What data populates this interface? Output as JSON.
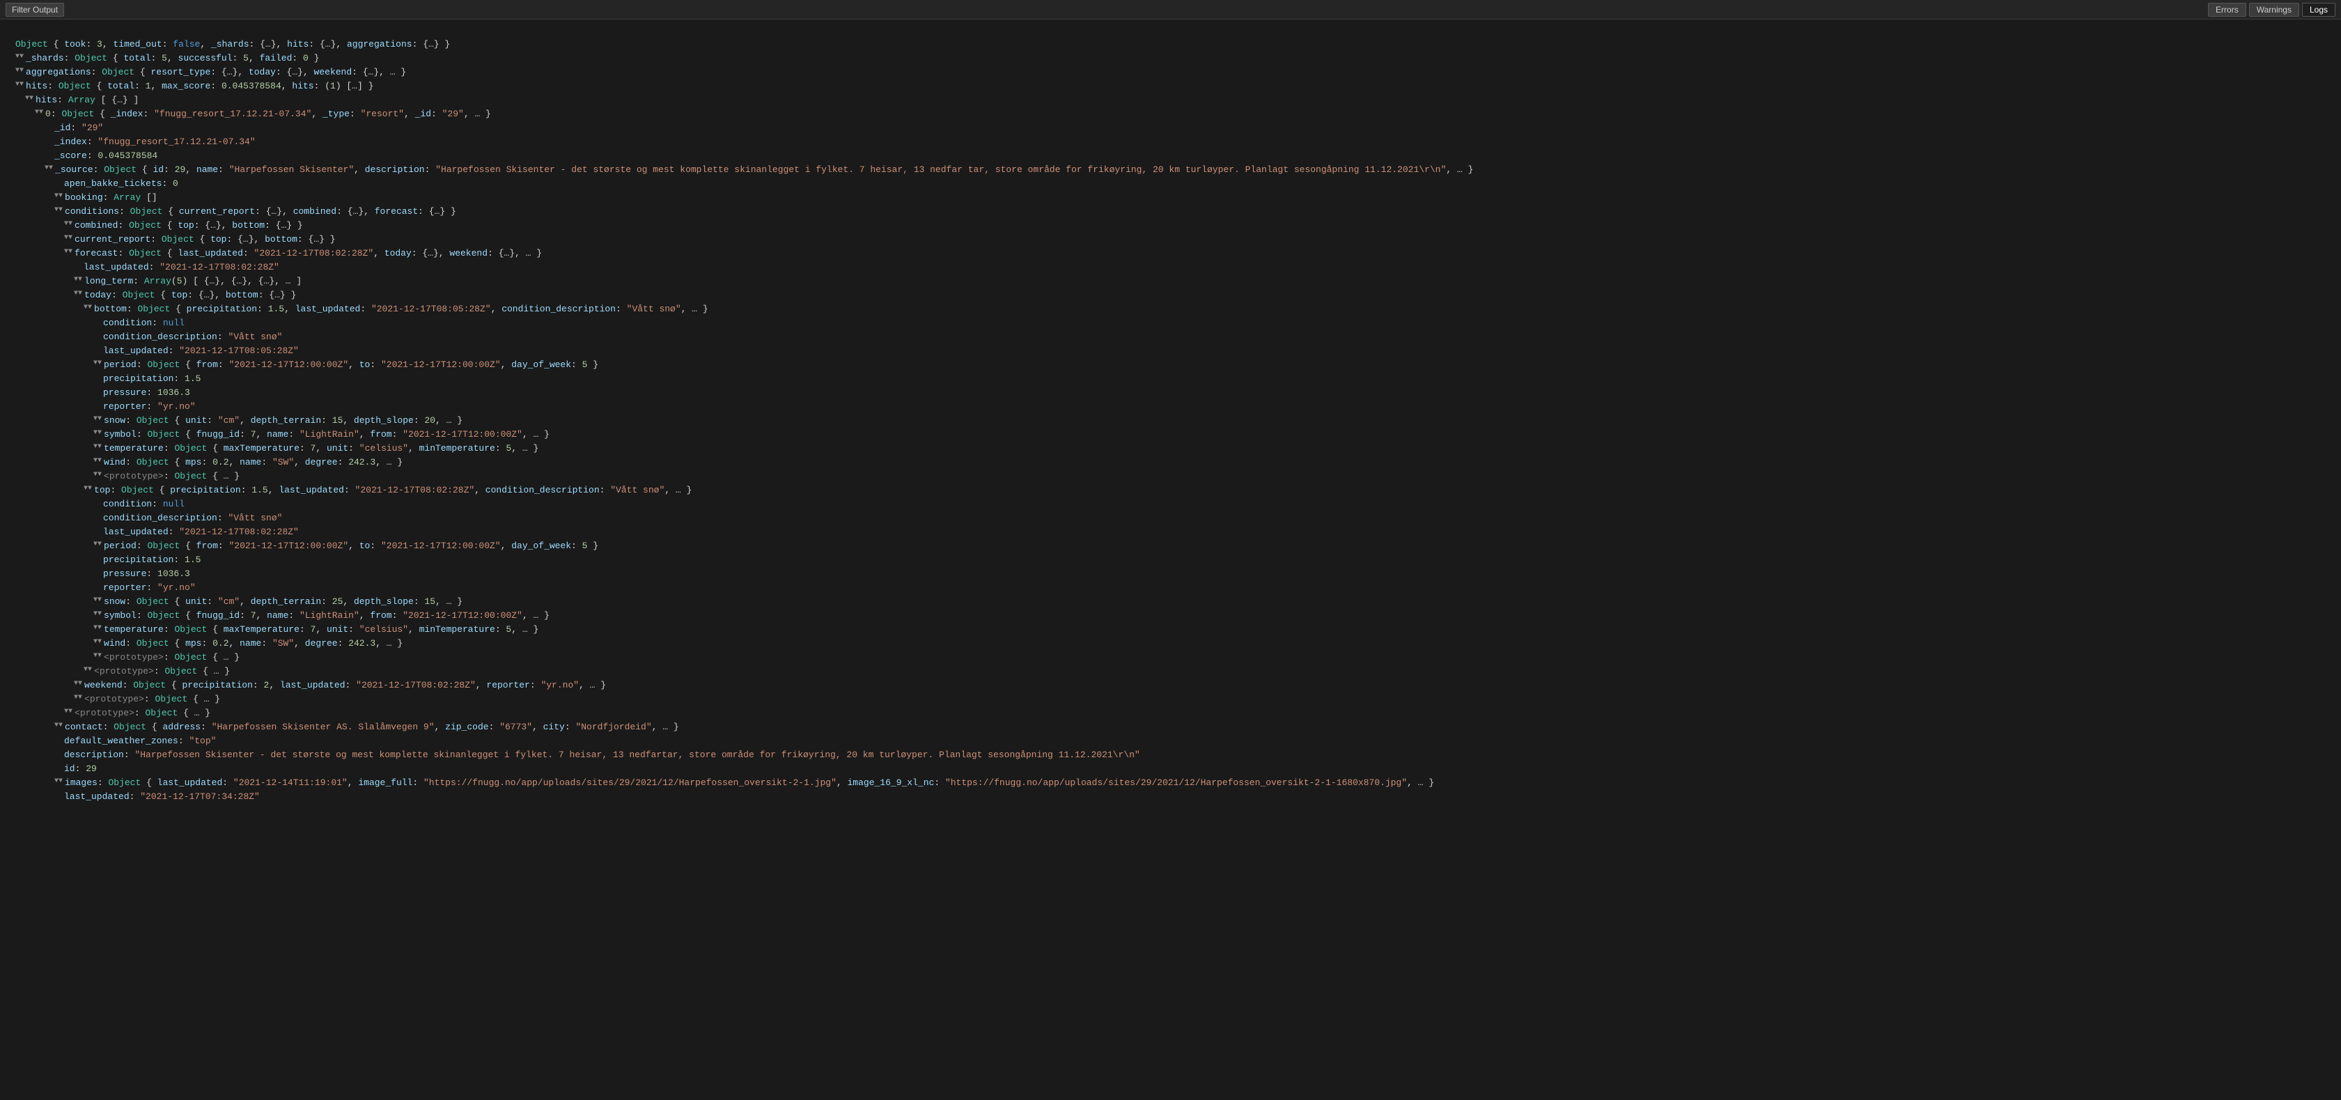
{
  "toolbar": {
    "filter_label": "Filter Output",
    "errors_label": "Errors",
    "warnings_label": "Warnings",
    "logs_label": "Logs"
  },
  "output": {
    "lines": [
      {
        "indent": 0,
        "toggle": false,
        "content": "Object { took: 3, timed_out: false, _shards: {…}, hits: {…}, aggregations: {…} }"
      },
      {
        "indent": 1,
        "toggle": true,
        "key": "_shards",
        "content": "_shards: Object { total: 5, successful: 5, failed: 0 }"
      },
      {
        "indent": 1,
        "toggle": true,
        "key": "aggregations",
        "content": "aggregations: Object { resort_type: {…}, today: {…}, weekend: {…}, … }"
      },
      {
        "indent": 1,
        "toggle": true,
        "key": "hits",
        "content": "hits: Object { total: 1, max_score: 0.045378584, hits: (1) […] }"
      },
      {
        "indent": 2,
        "toggle": true,
        "key": "hits",
        "content": "hits: Array [ {…} ]"
      },
      {
        "indent": 3,
        "toggle": true,
        "key": "0",
        "content": "0: Object { _index: \"fnugg_resort_17.12.21-07.34\", _type: \"resort\", _id: \"29\", … }"
      },
      {
        "indent": 4,
        "toggle": false,
        "key": "_id",
        "content": "_id: \"29\""
      },
      {
        "indent": 4,
        "toggle": false,
        "key": "_index",
        "content": "_index: \"fnugg_resort_17.12.21-07.34\""
      },
      {
        "indent": 4,
        "toggle": false,
        "key": "_score",
        "content": "_score: 0.045378584"
      },
      {
        "indent": 4,
        "toggle": true,
        "key": "_source",
        "content": "_source: Object { id: 29, name: \"Harpefossen Skisenter\", description: \"Harpefossen Skisenter - det største og mest komplette skinanlegget i fylket. 7 heisar, 13 nedfar tar, store område for frikøyring, 20 km turløyper. Planlagt sesongåpning 11.12.2021\\r\\n\", … }"
      },
      {
        "indent": 5,
        "toggle": false,
        "key": "apen_bakke_tickets",
        "content": "apen_bakke_tickets: 0"
      },
      {
        "indent": 5,
        "toggle": true,
        "key": "booking",
        "content": "booking: Array []"
      },
      {
        "indent": 5,
        "toggle": true,
        "key": "conditions",
        "content": "conditions: Object { current_report: {…}, combined: {…}, forecast: {…} }"
      },
      {
        "indent": 6,
        "toggle": true,
        "key": "combined",
        "content": "combined: Object { top: {…}, bottom: {…} }"
      },
      {
        "indent": 6,
        "toggle": true,
        "key": "current_report",
        "content": "current_report: Object { top: {…}, bottom: {…} }"
      },
      {
        "indent": 6,
        "toggle": true,
        "key": "forecast",
        "content": "forecast: Object { last_updated: \"2021-12-17T08:02:28Z\", today: {…}, weekend: {…}, … }"
      },
      {
        "indent": 7,
        "toggle": false,
        "key": "last_updated",
        "content": "last_updated: \"2021-12-17T08:02:28Z\""
      },
      {
        "indent": 7,
        "toggle": true,
        "key": "long_term",
        "content": "long_term: Array(5) [ {…}, {…}, {…}, … ]"
      },
      {
        "indent": 7,
        "toggle": true,
        "key": "today",
        "content": "today: Object { top: {…}, bottom: {…} }"
      },
      {
        "indent": 8,
        "toggle": true,
        "key": "bottom",
        "content": "bottom: Object { precipitation: 1.5, last_updated: \"2021-12-17T08:05:28Z\", condition_description: \"Vått snø\", … }"
      },
      {
        "indent": 9,
        "toggle": false,
        "key": "condition",
        "content": "condition: null"
      },
      {
        "indent": 9,
        "toggle": false,
        "key": "condition_description",
        "content": "condition_description: \"Vått snø\""
      },
      {
        "indent": 9,
        "toggle": false,
        "key": "last_updated",
        "content": "last_updated: \"2021-12-17T08:05:28Z\""
      },
      {
        "indent": 9,
        "toggle": true,
        "key": "period",
        "content": "period: Object { from: \"2021-12-17T12:00:00Z\", to: \"2021-12-17T12:00:00Z\", day_of_week: 5 }"
      },
      {
        "indent": 9,
        "toggle": false,
        "key": "precipitation",
        "content": "precipitation: 1.5"
      },
      {
        "indent": 9,
        "toggle": false,
        "key": "pressure",
        "content": "pressure: 1036.3"
      },
      {
        "indent": 9,
        "toggle": false,
        "key": "reporter",
        "content": "reporter: \"yr.no\""
      },
      {
        "indent": 9,
        "toggle": true,
        "key": "snow",
        "content": "snow: Object { unit: \"cm\", depth_terrain: 15, depth_slope: 20, … }"
      },
      {
        "indent": 9,
        "toggle": true,
        "key": "symbol",
        "content": "symbol: Object { fnugg_id: 7, name: \"LightRain\", from: \"2021-12-17T12:00:00Z\", … }"
      },
      {
        "indent": 9,
        "toggle": true,
        "key": "temperature",
        "content": "temperature: Object { maxTemperature: 7, unit: \"celsius\", minTemperature: 5, … }"
      },
      {
        "indent": 9,
        "toggle": true,
        "key": "wind",
        "content": "wind: Object { mps: 0.2, name: \"SW\", degree: 242.3, … }"
      },
      {
        "indent": 9,
        "toggle": true,
        "key": "<prototype>",
        "content": "<prototype>: Object { … }"
      },
      {
        "indent": 8,
        "toggle": true,
        "key": "top",
        "content": "top: Object { precipitation: 1.5, last_updated: \"2021-12-17T08:02:28Z\", condition_description: \"Vått snø\", … }"
      },
      {
        "indent": 9,
        "toggle": false,
        "key": "condition",
        "content": "condition: null"
      },
      {
        "indent": 9,
        "toggle": false,
        "key": "condition_description",
        "content": "condition_description: \"Vått snø\""
      },
      {
        "indent": 9,
        "toggle": false,
        "key": "last_updated",
        "content": "last_updated: \"2021-12-17T08:02:28Z\""
      },
      {
        "indent": 9,
        "toggle": true,
        "key": "period",
        "content": "period: Object { from: \"2021-12-17T12:00:00Z\", to: \"2021-12-17T12:00:00Z\", day_of_week: 5 }"
      },
      {
        "indent": 9,
        "toggle": false,
        "key": "precipitation",
        "content": "precipitation: 1.5"
      },
      {
        "indent": 9,
        "toggle": false,
        "key": "pressure",
        "content": "pressure: 1036.3"
      },
      {
        "indent": 9,
        "toggle": false,
        "key": "reporter",
        "content": "reporter: \"yr.no\""
      },
      {
        "indent": 9,
        "toggle": true,
        "key": "snow",
        "content": "snow: Object { unit: \"cm\", depth_terrain: 25, depth_slope: 15, … }"
      },
      {
        "indent": 9,
        "toggle": true,
        "key": "symbol",
        "content": "symbol: Object { fnugg_id: 7, name: \"LightRain\", from: \"2021-12-17T12:00:00Z\", … }"
      },
      {
        "indent": 9,
        "toggle": true,
        "key": "temperature",
        "content": "temperature: Object { maxTemperature: 7, unit: \"celsius\", minTemperature: 5, … }"
      },
      {
        "indent": 9,
        "toggle": true,
        "key": "wind",
        "content": "wind: Object { mps: 0.2, name: \"SW\", degree: 242.3, … }"
      },
      {
        "indent": 9,
        "toggle": true,
        "key": "<prototype>",
        "content": "<prototype>: Object { … }"
      },
      {
        "indent": 8,
        "toggle": true,
        "key": "<prototype>",
        "content": "<prototype>: Object { … }"
      },
      {
        "indent": 7,
        "toggle": true,
        "key": "weekend",
        "content": "weekend: Object { precipitation: 2, last_updated: \"2021-12-17T08:02:28Z\", reporter: \"yr.no\", … }"
      },
      {
        "indent": 7,
        "toggle": true,
        "key": "<prototype>",
        "content": "<prototype>: Object { … }"
      },
      {
        "indent": 6,
        "toggle": true,
        "key": "<prototype>",
        "content": "<prototype>: Object { … }"
      },
      {
        "indent": 5,
        "toggle": true,
        "key": "contact",
        "content": "contact: Object { address: \"Harpefossen Skisenter AS. Slalåmvegen 9\", zip_code: \"6773\", city: \"Nordfjordeid\", … }"
      },
      {
        "indent": 5,
        "toggle": false,
        "key": "default_weather_zones",
        "content": "default_weather_zones: \"top\""
      },
      {
        "indent": 5,
        "toggle": false,
        "key": "description",
        "content": "description: \"Harpefossen Skisenter - det største og mest komplette skinanlegget i fylket. 7 heisar, 13 nedfartar, store område for frikøyring, 20 km turløyper. Planlagt sesongåpning 11.12.2021\\r\\n\""
      },
      {
        "indent": 5,
        "toggle": false,
        "key": "id",
        "content": "id: 29"
      },
      {
        "indent": 5,
        "toggle": true,
        "key": "images",
        "content": "images: Object { last_updated: \"2021-12-14T11:19:01\", image_full: \"https://fnugg.no/app/uploads/sites/29/2021/12/Harpefossen_oversikt-2-1.jpg\", image_16_9_xl_nc: \"https://fnugg.no/app/uploads/sites/29/2021/12/Harpefossen_oversikt-2-1-1680x870.jpg\", … }"
      },
      {
        "indent": 5,
        "toggle": false,
        "key": "last_updated",
        "content": "last_updated: \"2021-12-17T07:34:28Z\""
      }
    ]
  }
}
